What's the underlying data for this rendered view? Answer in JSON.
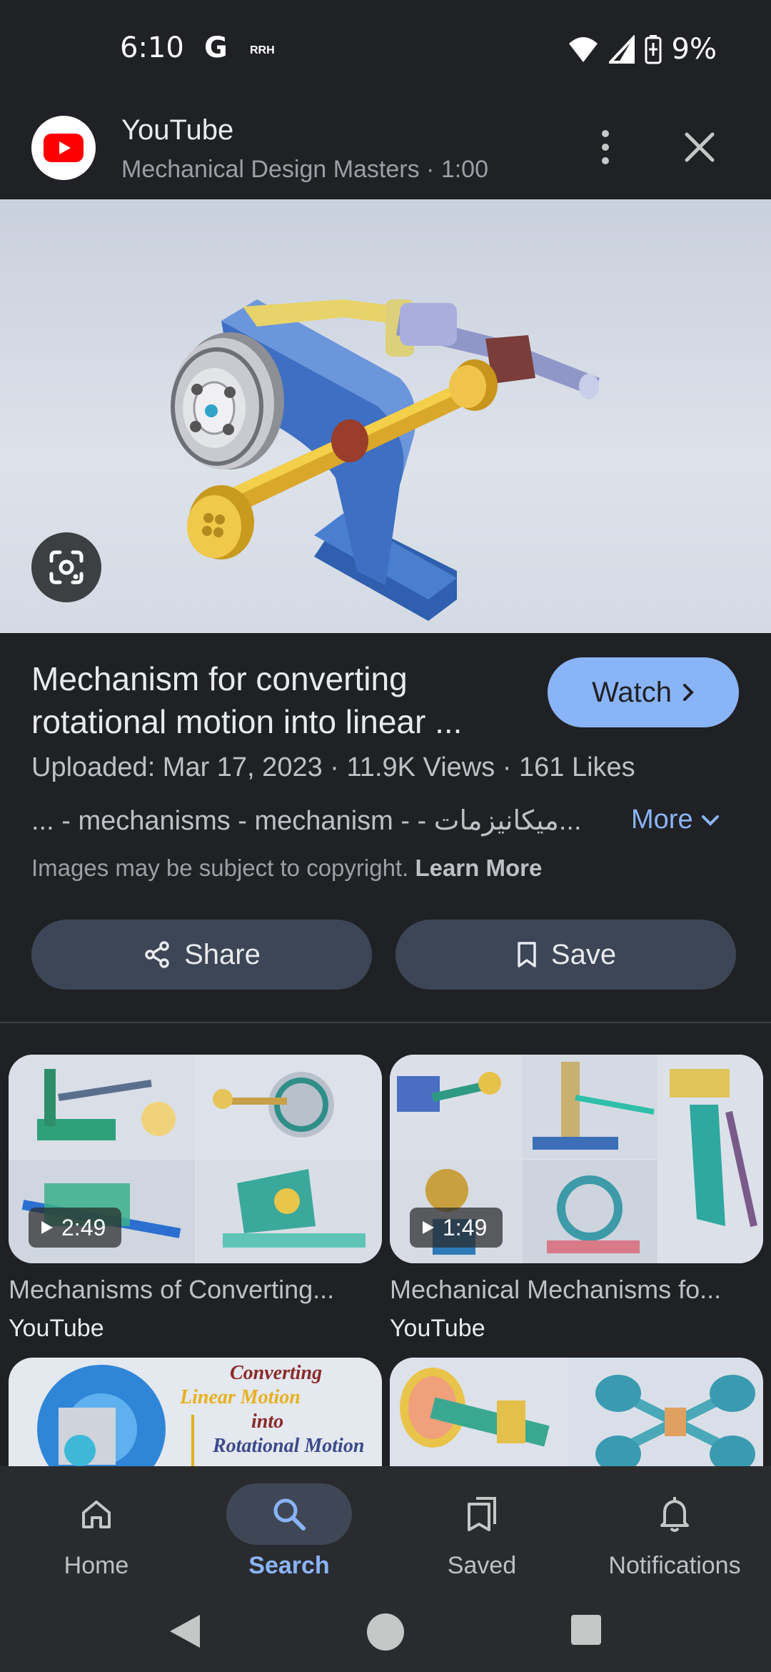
{
  "status_bar": {
    "time": "6:10",
    "google_glyph": "G",
    "carrier_tag": "RRH",
    "battery": "9%"
  },
  "header": {
    "source": "YouTube",
    "subtitle": "Mechanical Design Masters · 1:00"
  },
  "result": {
    "title": "Mechanism for converting rotational motion into linear ...",
    "watch_label": "Watch",
    "meta": "Uploaded: Mar 17, 2023 · 11.9K Views · 161 Likes",
    "tags": "... - mechanisms - mechanism - - میکانیزمات...",
    "more_label": "More",
    "copyright_text": "Images may be subject to copyright.",
    "learn_more": "Learn More",
    "share_label": "Share",
    "save_label": "Save"
  },
  "related": [
    {
      "title": "Mechanisms of Converting...",
      "source": "YouTube",
      "duration": "2:49"
    },
    {
      "title": "Mechanical Mechanisms fo...",
      "source": "YouTube",
      "duration": "1:49"
    }
  ],
  "partial_cards": {
    "text_lines": [
      "Converting",
      "Linear Motion",
      "into",
      "Rotational Motion"
    ]
  },
  "bottom_nav": [
    {
      "label": "Home"
    },
    {
      "label": "Search"
    },
    {
      "label": "Saved"
    },
    {
      "label": "Notifications"
    }
  ],
  "colors": {
    "background": "#202124",
    "accent": "#8ab4f8",
    "youtube_red": "#ff0000",
    "pill": "#3c4656"
  }
}
